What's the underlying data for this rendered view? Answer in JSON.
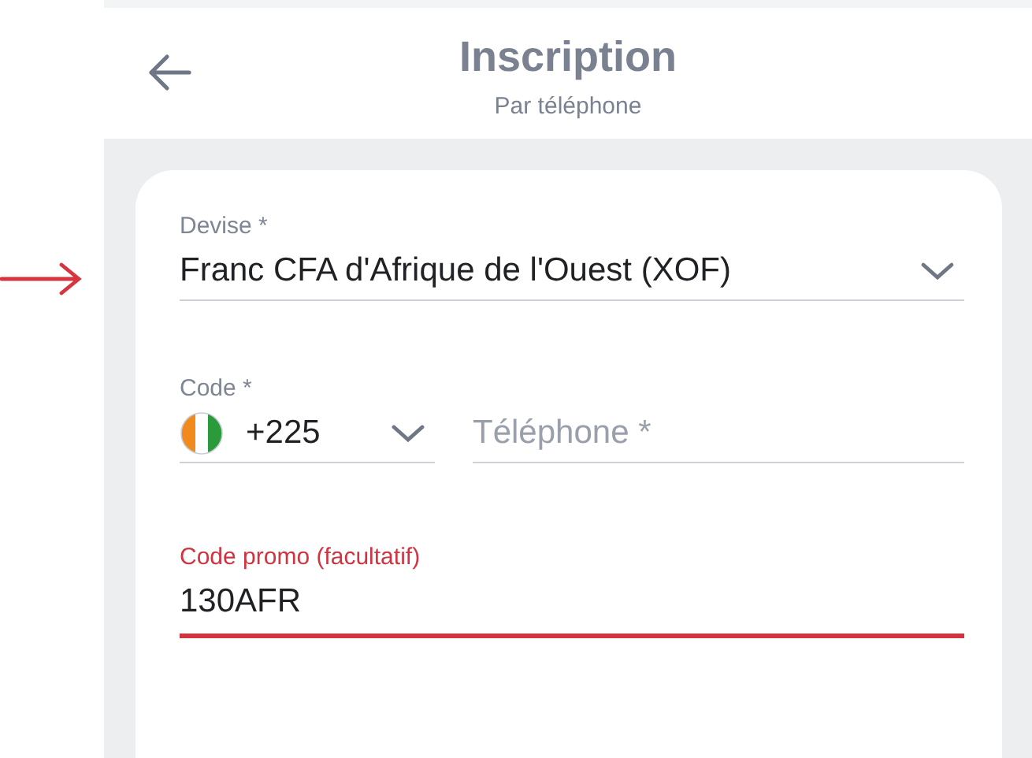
{
  "header": {
    "title": "Inscription",
    "subtitle": "Par téléphone"
  },
  "currency_field": {
    "label": "Devise *",
    "value": "Franc CFA d'Afrique de l'Ouest (XOF)"
  },
  "phone_row": {
    "code_label": "Code *",
    "code_value": "+225",
    "phone_placeholder": "Téléphone *"
  },
  "promo_field": {
    "label": "Code promo (facultatif)",
    "value": "130AFR",
    "focused": true
  }
}
